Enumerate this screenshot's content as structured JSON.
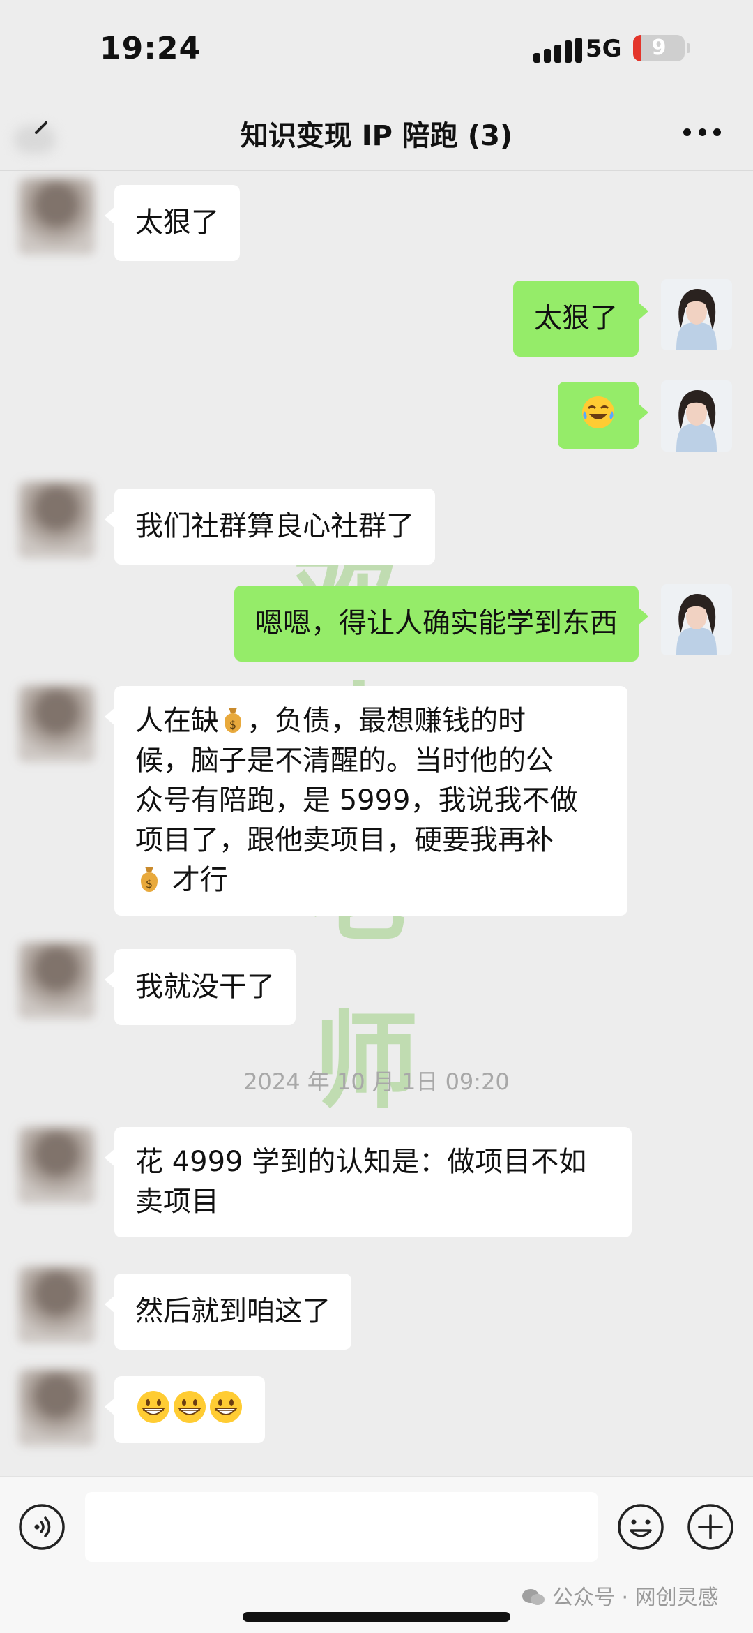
{
  "status": {
    "time": "19:24",
    "network": "5G",
    "battery": "9"
  },
  "header": {
    "title": "知识变现 IP 陪跑 (3)"
  },
  "messages": [
    {
      "side": "in",
      "text": "太狠了"
    },
    {
      "side": "out",
      "text": "太狠了"
    },
    {
      "side": "out",
      "emoji": "tears-of-joy"
    },
    {
      "side": "in",
      "text": "我们社群算良心社群了"
    },
    {
      "side": "out",
      "text": "嗯嗯，得让人确实能学到东西"
    },
    {
      "side": "in",
      "parts": [
        "人在缺",
        "，负债，最想赚钱的时",
        "候，脑子是不清醒的。当时他的公",
        "众号有陪跑，是 5999，我说我不做",
        "项目了，跟他卖项目，硬要我再补",
        "才行"
      ]
    },
    {
      "side": "in",
      "text": "我就没干了"
    },
    {
      "timestamp": "2024 年 10 月 1日 09:20"
    },
    {
      "side": "in",
      "lines": [
        "花 4999 学到的认知是：做项目不如",
        "卖项目"
      ]
    },
    {
      "side": "in",
      "text": "然后就到咱这了"
    },
    {
      "side": "in",
      "emoji": "grinning-x3"
    }
  ],
  "watermark": {
    "chars": [
      "欢",
      "喜",
      "老",
      "师"
    ]
  },
  "footer": {
    "label": "公众号 · 网创灵感"
  },
  "colors": {
    "bubble_out": "#95ec69",
    "bubble_in": "#ffffff",
    "background": "#ededed"
  }
}
